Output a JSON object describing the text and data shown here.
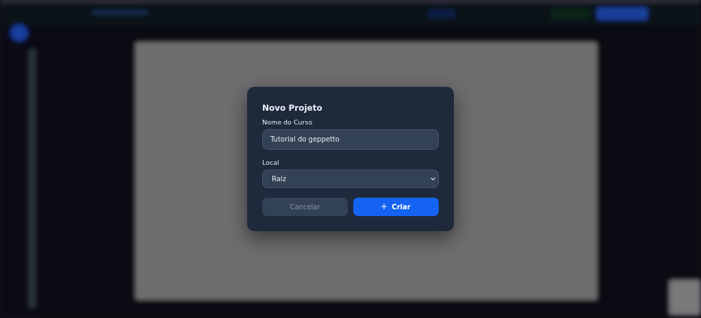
{
  "dialog": {
    "title": "Novo Projeto",
    "fields": [
      {
        "kind": "text",
        "label": "Nome do Curso",
        "value": "Tutorial do geppetto"
      },
      {
        "kind": "select",
        "label": "Local",
        "value": "Raiz"
      }
    ],
    "buttons": [
      {
        "kind": "secondary",
        "label": "Cancelar"
      },
      {
        "kind": "primary",
        "label": "Criar"
      }
    ]
  }
}
